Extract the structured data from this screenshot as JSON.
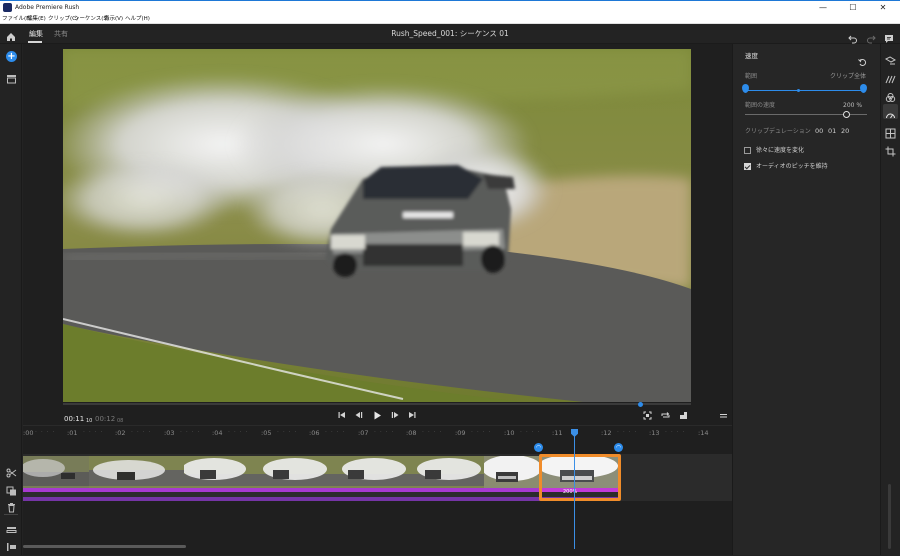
{
  "window": {
    "title": "Adobe Premiere Rush",
    "minimize": "—",
    "maximize": "☐",
    "close": "✕"
  },
  "menu": [
    "ファイル(F)",
    "編集(E)",
    "クリップ(C)",
    "シーケンス(S)",
    "表示(V)",
    "ヘルプ(H)"
  ],
  "header": {
    "tabs": [
      {
        "label": "編集",
        "active": true
      },
      {
        "label": "共有",
        "active": false
      }
    ],
    "sequence_title": "Rush_Speed_001: シーケンス 01"
  },
  "monitor": {
    "current_time": "00:11",
    "current_frames": "10",
    "duration": "00:12",
    "duration_frames": "08",
    "progress": 0.92
  },
  "timeline": {
    "ticks": [
      ":00",
      ":01",
      ":02",
      ":03",
      ":04",
      ":05",
      ":06",
      ":07",
      ":08",
      ":09",
      ":10",
      ":11",
      ":12",
      ":13",
      ":14"
    ],
    "speed_badge": "200%"
  },
  "panel": {
    "title": "速度",
    "range_label": "範囲",
    "range_value": "クリップ全体",
    "speed_label": "範囲の速度",
    "speed_value": "200 %",
    "speed_level": 0.83,
    "duration_label": "クリップデュレーション",
    "duration_values": [
      "00",
      "01",
      "20"
    ],
    "ramp_label": "徐々に速度を変化",
    "ramp_checked": false,
    "pitch_label": "オーディオのピッチを維持",
    "pitch_checked": true
  },
  "colors": {
    "accent": "#2d8ceb",
    "selection": "#f08c2a",
    "video_bar": "#a73ad0",
    "audio_bar": "#7535a6"
  }
}
